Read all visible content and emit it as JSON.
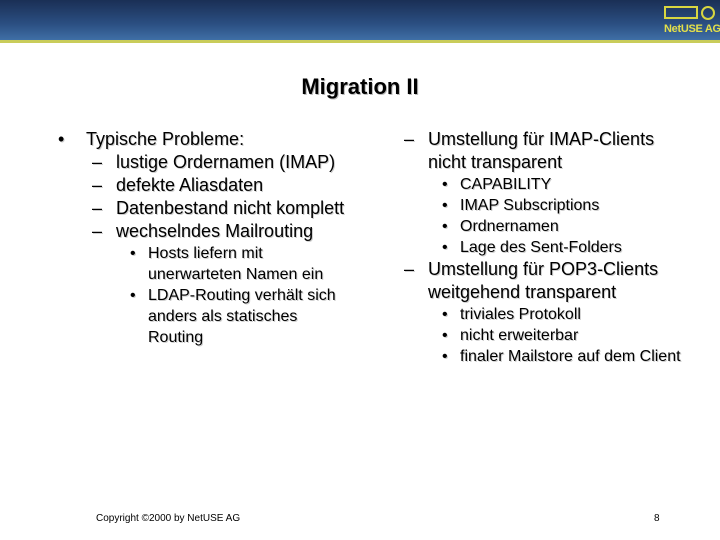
{
  "header": {
    "logo_text": "NetUSE AG",
    "band_color": "#2b4f82",
    "accent_color": "#c9cc5a"
  },
  "slide": {
    "title": "Migration II"
  },
  "left_column": {
    "item1": "Typische Probleme:",
    "item1_sub1": "lustige Ordernamen (IMAP)",
    "item1_sub2": "defekte Aliasdaten",
    "item1_sub3": "Datenbestand nicht komplett",
    "item1_sub4": "wechselndes Mailrouting",
    "item1_sub4_a": "Hosts liefern mit unerwarteten Namen ein",
    "item1_sub4_b": "LDAP-Routing verhält sich anders als statisches Routing"
  },
  "right_column": {
    "group1": "Umstellung für IMAP-Clients nicht transparent",
    "group1_a": "CAPABILITY",
    "group1_b": "IMAP Subscriptions",
    "group1_c": "Ordnernamen",
    "group1_d": "Lage des Sent-Folders",
    "group2": "Umstellung für POP3-Clients weitgehend transparent",
    "group2_a": "triviales Protokoll",
    "group2_b": "nicht erweiterbar",
    "group2_c": "finaler Mailstore auf dem Client"
  },
  "markers": {
    "bullet": "•",
    "dash": "–"
  },
  "footer": {
    "copyright": "Copyright ©2000 by NetUSE AG",
    "page_number": "8"
  }
}
